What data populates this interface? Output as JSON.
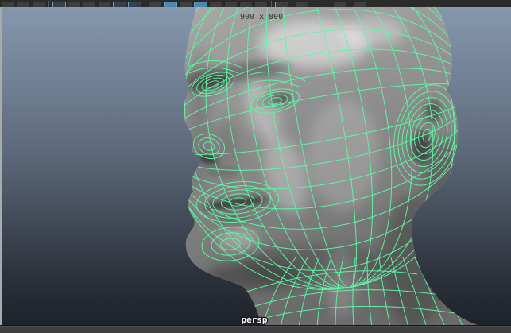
{
  "viewport": {
    "resolution_gate_label": "900 x 800",
    "camera_label": "persp"
  },
  "toolbar": {
    "buttons": [
      {
        "state": "plain"
      },
      {
        "state": "plain"
      },
      {
        "state": "plain"
      },
      {
        "state": "sep"
      },
      {
        "state": "outlined"
      },
      {
        "state": "plain"
      },
      {
        "state": "plain"
      },
      {
        "state": "plain"
      },
      {
        "state": "outlined"
      },
      {
        "state": "outlined"
      },
      {
        "state": "sep"
      },
      {
        "state": "plain"
      },
      {
        "state": "filled"
      },
      {
        "state": "plain"
      },
      {
        "state": "filled"
      },
      {
        "state": "plain"
      },
      {
        "state": "plain"
      },
      {
        "state": "plain"
      },
      {
        "state": "plain"
      },
      {
        "state": "sep"
      },
      {
        "state": "gray"
      },
      {
        "state": "sep"
      },
      {
        "state": "plain"
      },
      {
        "state": "space"
      },
      {
        "state": "plain"
      },
      {
        "state": "sep"
      },
      {
        "state": "plain"
      }
    ]
  },
  "colors": {
    "wireframe": "#57fba3",
    "bg_top": "#8698ae",
    "bg_mid": "#5d6a7b",
    "bg_low": "#2b313a",
    "bg_bottom": "#1e222a",
    "toolbar_bg": "#2b2b2b",
    "button": "#3e3e3e",
    "button_active": "#4d87ac",
    "button_outline": "#63a0c4",
    "bottombar": "#3f3f41",
    "left_strip": "#a8abad",
    "label_dark": "#343a33",
    "label_light": "#ffffff",
    "head_light": "#a8a8a8",
    "head_dark": "#6a6a6a"
  }
}
